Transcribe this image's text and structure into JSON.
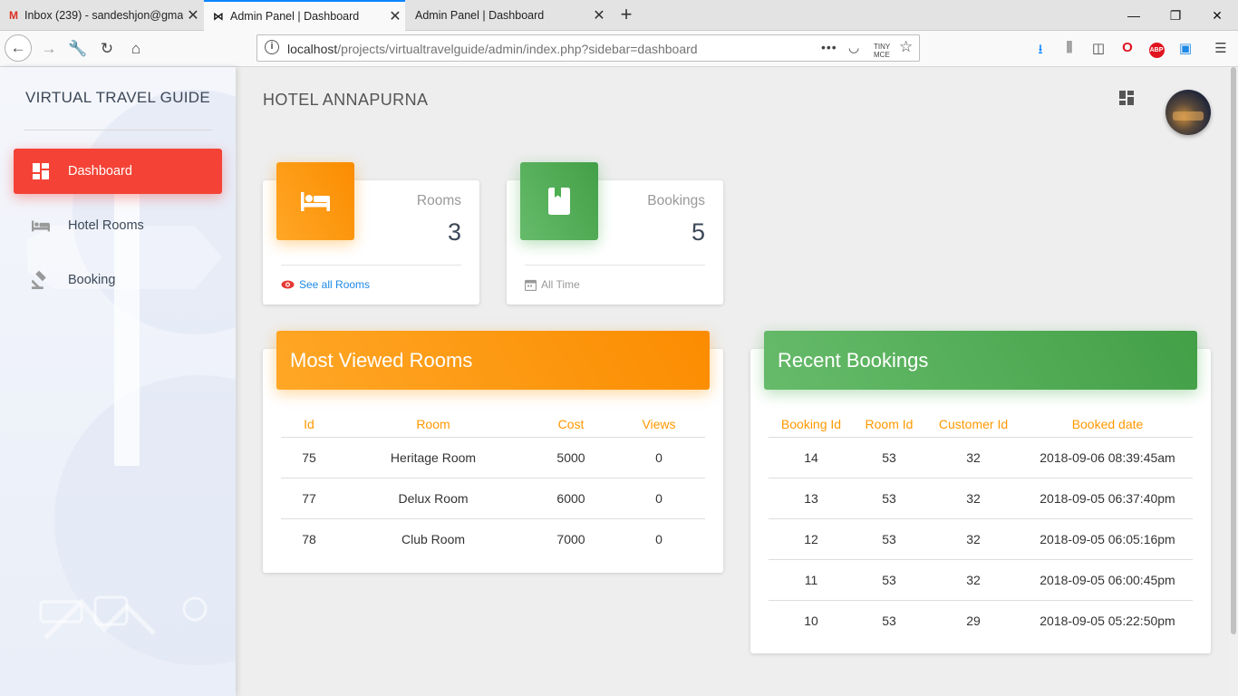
{
  "browser": {
    "tabs": [
      {
        "title": "Inbox (239) - sandeshjon@gma",
        "icon": "gmail-icon"
      },
      {
        "title": "Admin Panel | Dashboard",
        "icon": "bowtie-icon"
      },
      {
        "title": "Admin Panel | Dashboard",
        "icon": ""
      }
    ],
    "url": "localhost/projects/virtualtravelguide/admin/index.php?sidebar=dashboard",
    "url_host": "localhost",
    "url_path": "/projects/virtualtravelguide/admin/index.php?sidebar=dashboard"
  },
  "sidebar": {
    "brand": "VIRTUAL TRAVEL GUIDE",
    "items": [
      {
        "label": "Dashboard",
        "icon": "dashboard-icon",
        "active": true
      },
      {
        "label": "Hotel Rooms",
        "icon": "bed-icon",
        "active": false
      },
      {
        "label": "Booking",
        "icon": "gavel-icon",
        "active": false
      }
    ]
  },
  "header": {
    "title": "HOTEL ANNAPURNA"
  },
  "stats": {
    "rooms": {
      "label": "Rooms",
      "value": "3",
      "footer": "See all Rooms"
    },
    "bookings": {
      "label": "Bookings",
      "value": "5",
      "footer": "All Time"
    }
  },
  "most_viewed": {
    "title": "Most Viewed Rooms",
    "columns": [
      "Id",
      "Room",
      "Cost",
      "Views"
    ],
    "rows": [
      [
        "75",
        "Heritage Room",
        "5000",
        "0"
      ],
      [
        "77",
        "Delux Room",
        "6000",
        "0"
      ],
      [
        "78",
        "Club Room",
        "7000",
        "0"
      ]
    ]
  },
  "recent_bookings": {
    "title": "Recent Bookings",
    "columns": [
      "Booking Id",
      "Room Id",
      "Customer Id",
      "Booked date"
    ],
    "rows": [
      [
        "14",
        "53",
        "32",
        "2018-09-06 08:39:45am"
      ],
      [
        "13",
        "53",
        "32",
        "2018-09-05 06:37:40pm"
      ],
      [
        "12",
        "53",
        "32",
        "2018-09-05 06:05:16pm"
      ],
      [
        "11",
        "53",
        "32",
        "2018-09-05 06:00:45pm"
      ],
      [
        "10",
        "53",
        "29",
        "2018-09-05 05:22:50pm"
      ]
    ]
  },
  "colors": {
    "accent_red": "#f44336",
    "orange": "#ff9800",
    "green": "#4caf50",
    "link_blue": "#1e88e5"
  }
}
